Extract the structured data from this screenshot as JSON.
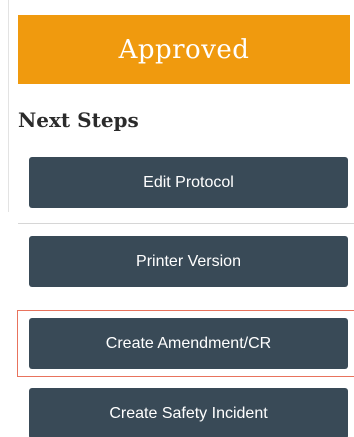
{
  "status": {
    "label": "Approved",
    "color": "#f09a0e"
  },
  "next_steps": {
    "title": "Next Steps",
    "buttons": [
      {
        "label": "Edit Protocol"
      },
      {
        "label": "Printer Version"
      },
      {
        "label": "Create Amendment/CR",
        "highlighted": true
      },
      {
        "label": "Create Safety Incident"
      }
    ]
  },
  "colors": {
    "button_bg": "#394a57",
    "highlight_border": "#e8735d"
  }
}
